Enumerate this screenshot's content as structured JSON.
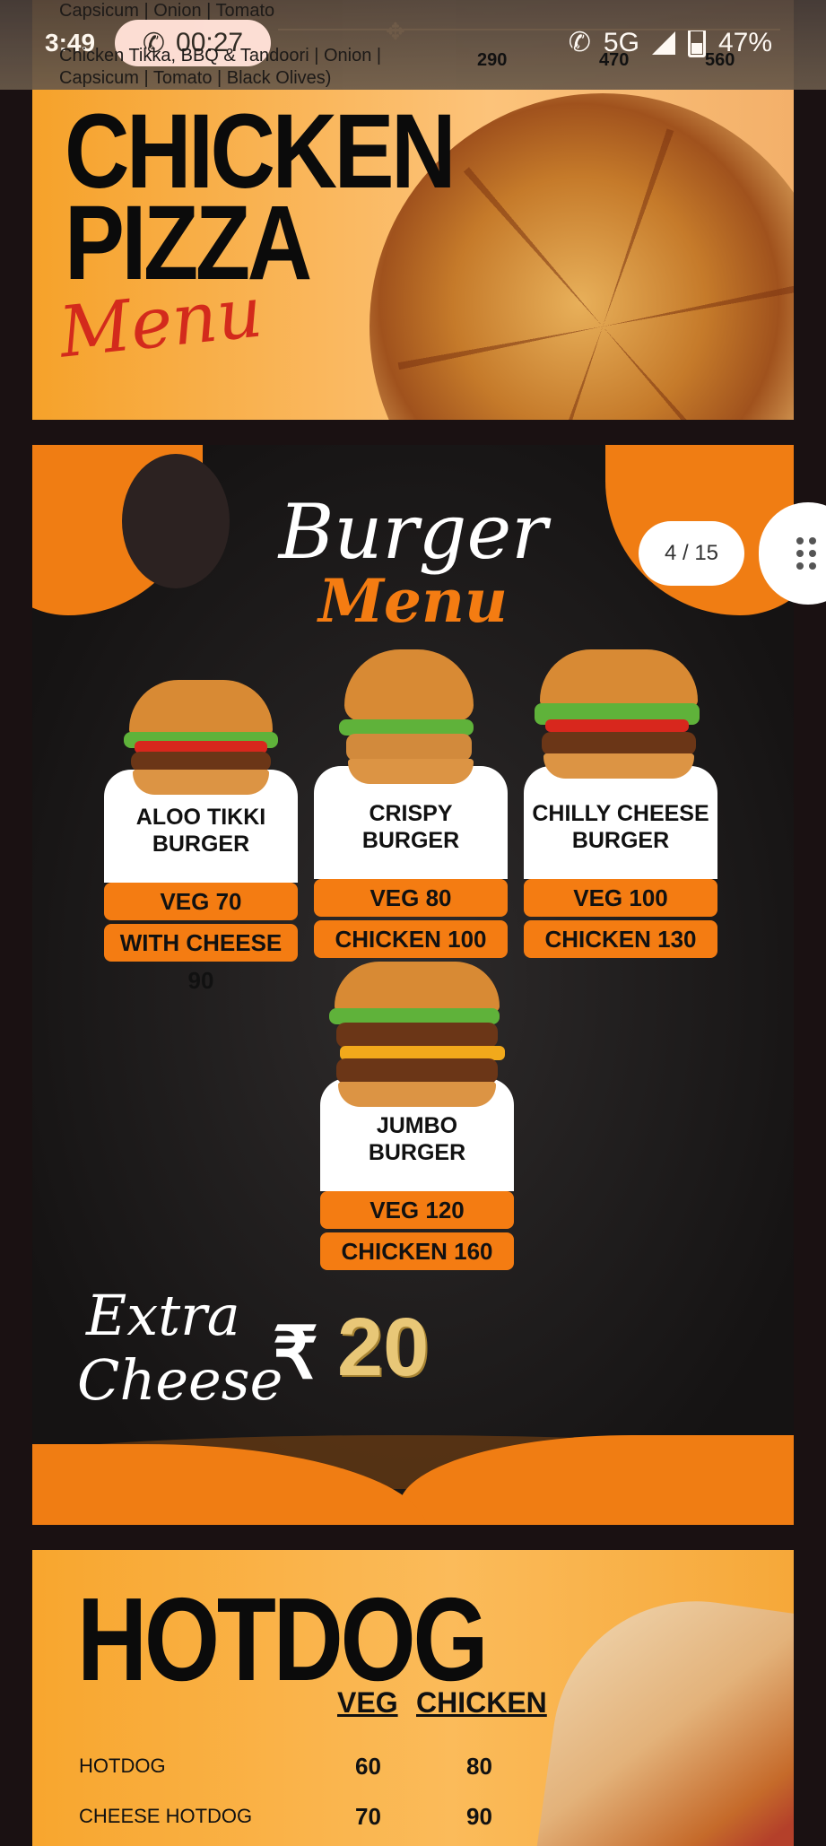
{
  "status_bar": {
    "time": "3:49",
    "call_timer": "00:27",
    "network": "5G",
    "battery": "47%"
  },
  "prev_page_ghost": {
    "line1": "Capsicum | Onion | Tomato",
    "line2": "Chicken Tikka, BBQ & Tandoori | Onion |",
    "line3": "Capsicum | Tomato | Black Olives)",
    "prices": [
      "290",
      "470",
      "560"
    ]
  },
  "pizza_page": {
    "title_line1": "CHICKEN",
    "title_line2": "PIZZA",
    "script": "Menu"
  },
  "burger_page": {
    "title": "Burger",
    "subtitle": "Menu",
    "items": [
      {
        "name_line1": "ALOO TIKKI",
        "name_line2": "BURGER",
        "price1": "VEG 70",
        "price2": "WITH CHEESE 90"
      },
      {
        "name_line1": "CRISPY",
        "name_line2": "BURGER",
        "price1": "VEG 80",
        "price2": "CHICKEN 100"
      },
      {
        "name_line1": "CHILLY CHEESE",
        "name_line2": "BURGER",
        "price1": "VEG 100",
        "price2": "CHICKEN 130"
      },
      {
        "name_line1": "JUMBO",
        "name_line2": "BURGER",
        "price1": "VEG 120",
        "price2": "CHICKEN 160"
      }
    ],
    "extra_line1": "Extra",
    "extra_line2": "Cheese",
    "currency": "₹",
    "extra_price": "20"
  },
  "page_indicator": "4 / 15",
  "hotdog_page": {
    "title": "HOTDOG",
    "col_veg": "VEG",
    "col_chicken": "CHICKEN",
    "rows": [
      {
        "name": "HOTDOG",
        "veg": "60",
        "chicken": "80"
      },
      {
        "name": "CHEESE HOTDOG",
        "veg": "70",
        "chicken": "90"
      }
    ]
  },
  "colors": {
    "accent": "#f47c12",
    "background": "#1a1112"
  },
  "icons": [
    "phone-call-icon",
    "wifi-call-icon",
    "signal-icon",
    "battery-icon",
    "drag-handle-icon"
  ]
}
